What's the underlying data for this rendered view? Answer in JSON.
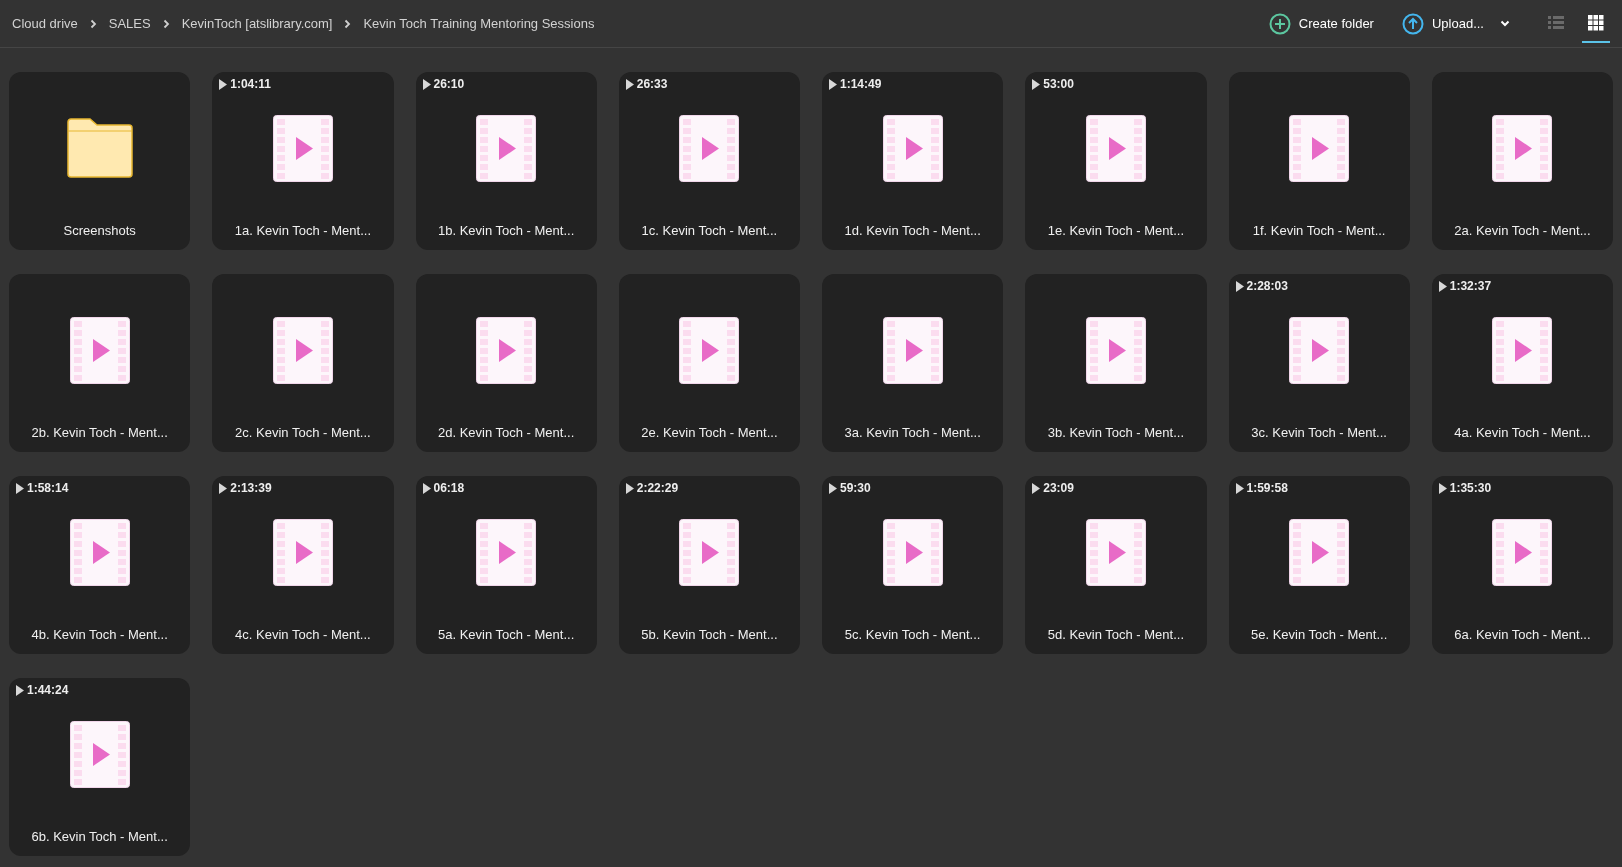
{
  "breadcrumbs": [
    "Cloud drive",
    "SALES",
    "KevinToch [atslibrary.com]",
    "Kevin Toch Training Mentoring Sessions"
  ],
  "actions": {
    "create_folder": "Create folder",
    "upload": "Upload..."
  },
  "view_modes": [
    {
      "kind": "list",
      "selected": false
    },
    {
      "kind": "grid",
      "selected": true
    }
  ],
  "items": [
    {
      "kind": "folder",
      "name": "Screenshots"
    },
    {
      "kind": "video",
      "name": "1a. Kevin Toch - Ment...",
      "duration": "1:04:11"
    },
    {
      "kind": "video",
      "name": "1b. Kevin Toch - Ment...",
      "duration": "26:10"
    },
    {
      "kind": "video",
      "name": "1c. Kevin Toch - Ment...",
      "duration": "26:33"
    },
    {
      "kind": "video",
      "name": "1d. Kevin Toch - Ment...",
      "duration": "1:14:49"
    },
    {
      "kind": "video",
      "name": "1e. Kevin Toch - Ment...",
      "duration": "53:00"
    },
    {
      "kind": "video",
      "name": "1f. Kevin Toch - Ment..."
    },
    {
      "kind": "video",
      "name": "2a. Kevin Toch - Ment..."
    },
    {
      "kind": "video",
      "name": "2b. Kevin Toch - Ment..."
    },
    {
      "kind": "video",
      "name": "2c. Kevin Toch - Ment..."
    },
    {
      "kind": "video",
      "name": "2d. Kevin Toch - Ment..."
    },
    {
      "kind": "video",
      "name": "2e. Kevin Toch - Ment..."
    },
    {
      "kind": "video",
      "name": "3a. Kevin Toch - Ment..."
    },
    {
      "kind": "video",
      "name": "3b. Kevin Toch - Ment..."
    },
    {
      "kind": "video",
      "name": "3c. Kevin Toch - Ment...",
      "duration": "2:28:03"
    },
    {
      "kind": "video",
      "name": "4a. Kevin Toch - Ment...",
      "duration": "1:32:37"
    },
    {
      "kind": "video",
      "name": "4b. Kevin Toch - Ment...",
      "duration": "1:58:14"
    },
    {
      "kind": "video",
      "name": "4c. Kevin Toch - Ment...",
      "duration": "2:13:39"
    },
    {
      "kind": "video",
      "name": "5a. Kevin Toch - Ment...",
      "duration": "06:18"
    },
    {
      "kind": "video",
      "name": "5b. Kevin Toch - Ment...",
      "duration": "2:22:29"
    },
    {
      "kind": "video",
      "name": "5c. Kevin Toch - Ment...",
      "duration": "59:30"
    },
    {
      "kind": "video",
      "name": "5d. Kevin Toch - Ment...",
      "duration": "23:09"
    },
    {
      "kind": "video",
      "name": "5e. Kevin Toch - Ment...",
      "duration": "1:59:58"
    },
    {
      "kind": "video",
      "name": "6a. Kevin Toch - Ment...",
      "duration": "1:35:30"
    },
    {
      "kind": "video",
      "name": "6b. Kevin Toch - Ment...",
      "duration": "1:44:24"
    }
  ]
}
